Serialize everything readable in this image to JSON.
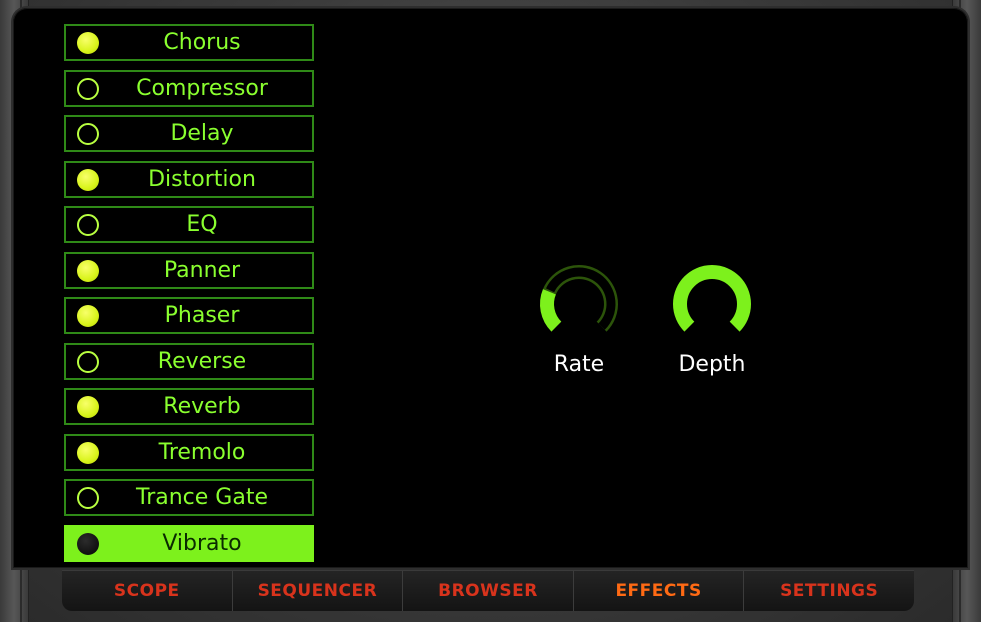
{
  "effects": {
    "items": [
      {
        "label": "Chorus",
        "enabled": true
      },
      {
        "label": "Compressor",
        "enabled": false
      },
      {
        "label": "Delay",
        "enabled": false
      },
      {
        "label": "Distortion",
        "enabled": true
      },
      {
        "label": "EQ",
        "enabled": false
      },
      {
        "label": "Panner",
        "enabled": true
      },
      {
        "label": "Phaser",
        "enabled": true
      },
      {
        "label": "Reverse",
        "enabled": false
      },
      {
        "label": "Reverb",
        "enabled": true
      },
      {
        "label": "Tremolo",
        "enabled": true
      },
      {
        "label": "Trance Gate",
        "enabled": false
      },
      {
        "label": "Vibrato",
        "enabled": false,
        "selected": true
      }
    ]
  },
  "knobs": [
    {
      "label": "Rate",
      "value": 0.25
    },
    {
      "label": "Depth",
      "value": 1.0
    }
  ],
  "tabs": [
    {
      "label": "SCOPE",
      "active": false
    },
    {
      "label": "SEQUENCER",
      "active": false
    },
    {
      "label": "BROWSER",
      "active": false
    },
    {
      "label": "EFFECTS",
      "active": true
    },
    {
      "label": "SETTINGS",
      "active": false
    }
  ],
  "colors": {
    "accent_green": "#7df11c",
    "led_on": "#e4f824",
    "tab_text": "#d8331c",
    "tab_active": "#ff6a14"
  }
}
